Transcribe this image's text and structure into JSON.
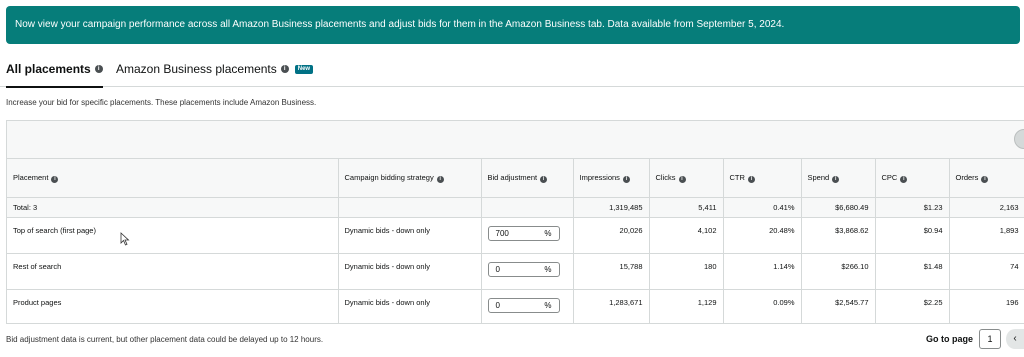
{
  "banner": {
    "text": "Now view your campaign performance across all Amazon Business placements and adjust bids for them in the Amazon Business tab. Data available from September 5, 2024."
  },
  "tabs": [
    {
      "label": "All placements",
      "active": true
    },
    {
      "label": "Amazon Business placements",
      "badge": "New",
      "active": false
    }
  ],
  "description": "Increase your bid for specific placements. These placements include Amazon Business.",
  "table": {
    "columns": [
      "Placement",
      "Campaign bidding strategy",
      "Bid adjustment",
      "Impressions",
      "Clicks",
      "CTR",
      "Spend",
      "CPC",
      "Orders"
    ],
    "total": {
      "label": "Total: 3",
      "impressions": "1,319,485",
      "clicks": "5,411",
      "ctr": "0.41%",
      "spend": "$6,680.49",
      "cpc": "$1.23",
      "orders": "2,163"
    },
    "rows": [
      {
        "placement": "Top of search (first page)",
        "strategy": "Dynamic bids - down only",
        "bid": "700",
        "unit": "%",
        "impressions": "20,026",
        "clicks": "4,102",
        "ctr": "20.48%",
        "spend": "$3,868.62",
        "cpc": "$0.94",
        "orders": "1,893"
      },
      {
        "placement": "Rest of search",
        "strategy": "Dynamic bids - down only",
        "bid": "0",
        "unit": "%",
        "impressions": "15,788",
        "clicks": "180",
        "ctr": "1.14%",
        "spend": "$266.10",
        "cpc": "$1.48",
        "orders": "74"
      },
      {
        "placement": "Product pages",
        "strategy": "Dynamic bids - down only",
        "bid": "0",
        "unit": "%",
        "impressions": "1,283,671",
        "clicks": "1,129",
        "ctr": "0.09%",
        "spend": "$2,545.77",
        "cpc": "$2.25",
        "orders": "196"
      }
    ]
  },
  "footer": {
    "note": "Bid adjustment data is current, but other placement data could be delayed up to 12 hours.",
    "go_to_page_label": "Go to page",
    "page": "1"
  },
  "icons": {
    "info": "info-icon",
    "cursor": "mouse-pointer-icon",
    "prev": "chevron-left-icon",
    "settings": "settings-circle-icon"
  },
  "colors": {
    "banner": "#067d7a",
    "badge": "#007185"
  }
}
